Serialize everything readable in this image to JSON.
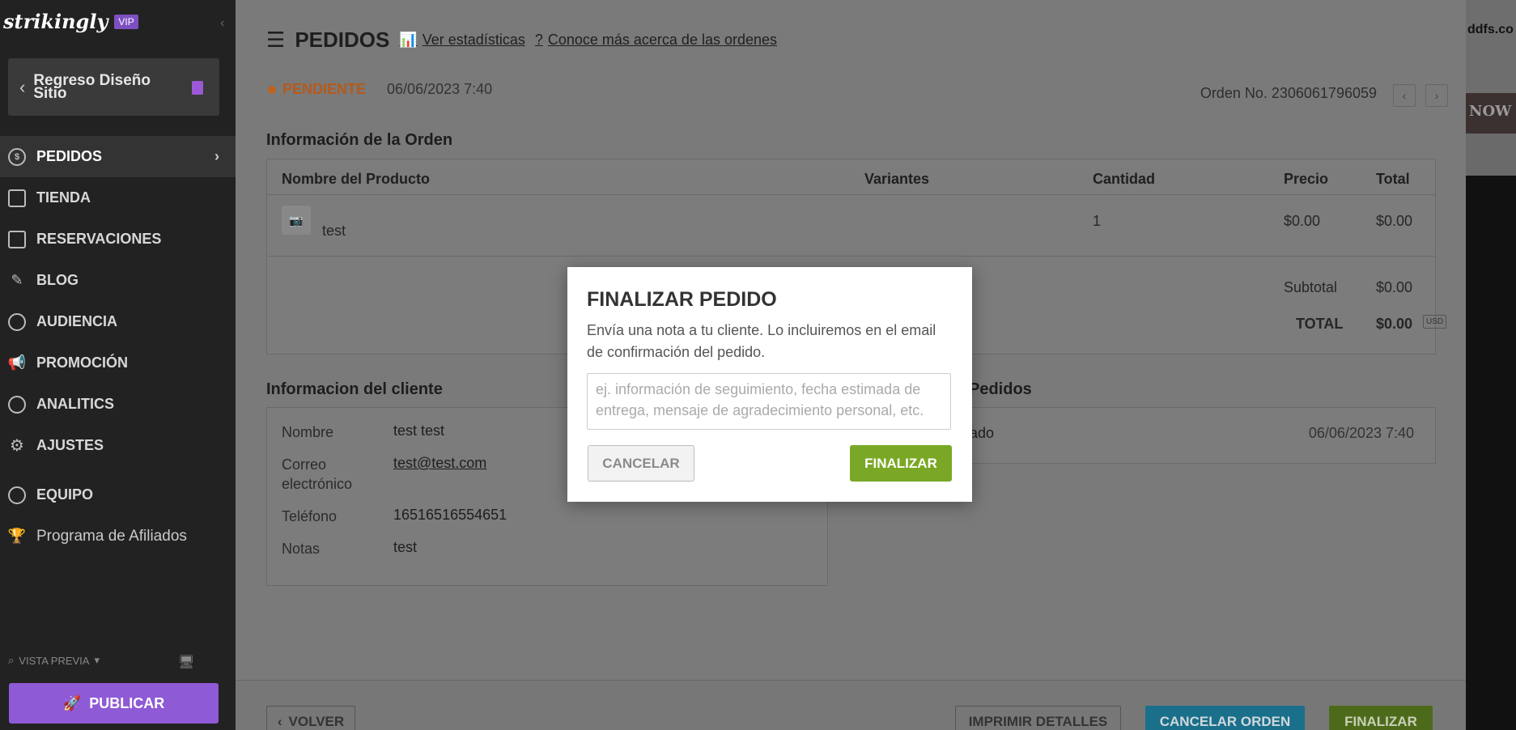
{
  "sidebar": {
    "brand": "strikingly",
    "vip": "VIP",
    "back_label": "Regreso Diseño Sitio",
    "items": [
      {
        "label": "PEDIDOS"
      },
      {
        "label": "TIENDA"
      },
      {
        "label": "RESERVACIONES"
      },
      {
        "label": "BLOG"
      },
      {
        "label": "AUDIENCIA"
      },
      {
        "label": "PROMOCIÓN"
      },
      {
        "label": "ANALITICS"
      },
      {
        "label": "AJUSTES"
      }
    ],
    "team": "EQUIPO",
    "affiliate": "Programa de Afiliados",
    "preview": "VISTA PREVIA",
    "publish": "PUBLICAR"
  },
  "header": {
    "title": "PEDIDOS",
    "stats_link": "Ver estadísticas",
    "help_link": "Conoce más acerca de las ordenes"
  },
  "order": {
    "status": "PENDIENTE",
    "date": "06/06/2023 7:40",
    "number": "Orden No. 2306061796059"
  },
  "order_info": {
    "title": "Información de la Orden",
    "columns": [
      "Nombre del Producto",
      "Variantes",
      "Cantidad",
      "Precio",
      "Total"
    ],
    "rows": [
      {
        "product": "test",
        "variants": "",
        "qty": "1",
        "price": "$0.00",
        "total": "$0.00"
      }
    ],
    "subtotal_label": "Subtotal",
    "subtotal": "$0.00",
    "total_label": "TOTAL",
    "total": "$0.00",
    "currency": "USD"
  },
  "customer": {
    "title": "Informacion del cliente",
    "name_label": "Nombre",
    "name": "test test",
    "email_label": "Correo electrónico",
    "email": "test@test.com",
    "phone_label": "Teléfono",
    "phone": "16516516554651",
    "notes_label": "Notas",
    "notes": "test"
  },
  "history": {
    "title_partial": "Pedidos",
    "item_partial": "ado",
    "date": "06/06/2023 7:40"
  },
  "footer": {
    "back": "VOLVER",
    "print": "IMPRIMIR DETALLES",
    "cancel_order": "CANCELAR ORDEN",
    "finalize": "FINALIZAR"
  },
  "strip": {
    "top_text": "ddfs.co",
    "now_text": "NOW"
  },
  "modal": {
    "title": "FINALIZAR PEDIDO",
    "description": "Envía una nota a tu cliente. Lo incluiremos en el email de confirmación del pedido.",
    "placeholder": "ej. información de seguimiento, fecha estimada de entrega, mensaje de agradecimiento personal, etc.",
    "cancel": "CANCELAR",
    "confirm": "FINALIZAR"
  }
}
